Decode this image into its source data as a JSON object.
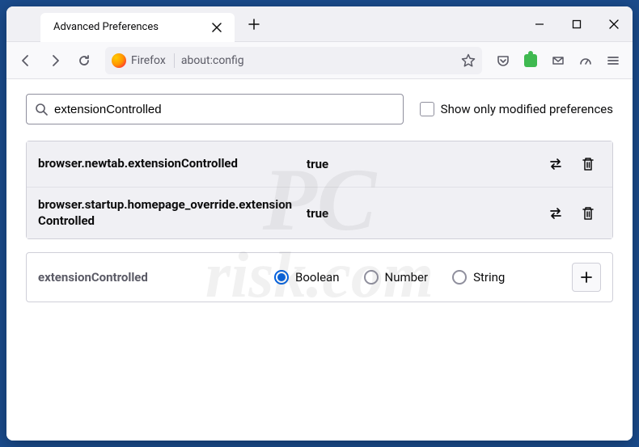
{
  "tab": {
    "title": "Advanced Preferences"
  },
  "urlbar": {
    "identity": "Firefox",
    "address": "about:config"
  },
  "search": {
    "value": "extensionControlled"
  },
  "filter": {
    "showOnlyModified": "Show only modified preferences"
  },
  "prefs": [
    {
      "name": "browser.newtab.extensionControlled",
      "value": "true"
    },
    {
      "name": "browser.startup.homepage_override.extensionControlled",
      "value": "true"
    }
  ],
  "newPref": {
    "name": "extensionControlled",
    "types": {
      "boolean": "Boolean",
      "number": "Number",
      "string": "String"
    }
  },
  "watermark": {
    "line1": "PC",
    "line2": "risk.com"
  }
}
